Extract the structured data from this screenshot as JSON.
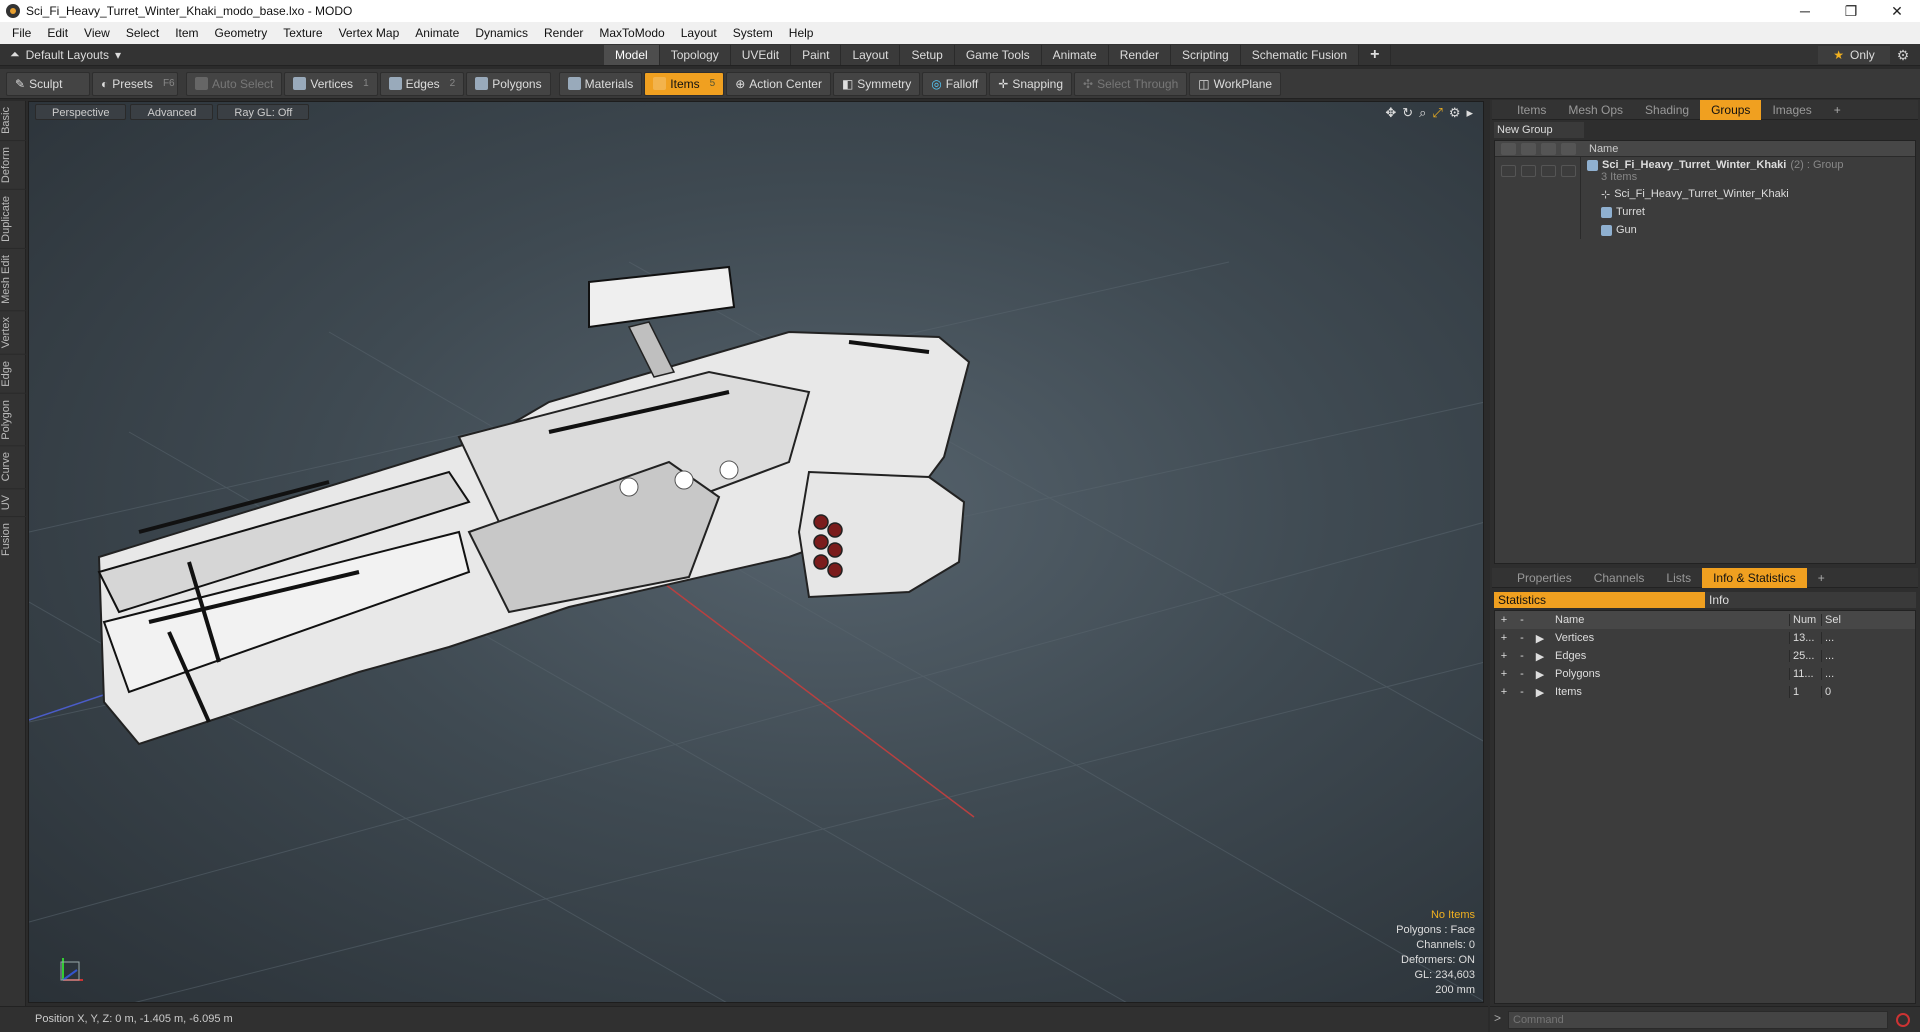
{
  "window": {
    "title": "Sci_Fi_Heavy_Turret_Winter_Khaki_modo_base.lxo - MODO"
  },
  "menu": [
    "File",
    "Edit",
    "View",
    "Select",
    "Item",
    "Geometry",
    "Texture",
    "Vertex Map",
    "Animate",
    "Dynamics",
    "Render",
    "MaxToModo",
    "Layout",
    "System",
    "Help"
  ],
  "layout": {
    "label": "Default Layouts",
    "tabs": [
      "Model",
      "Topology",
      "UVEdit",
      "Paint",
      "Layout",
      "Setup",
      "Game Tools",
      "Animate",
      "Render",
      "Scripting",
      "Schematic Fusion"
    ],
    "plus": "+",
    "only": "Only"
  },
  "toolbar": {
    "sculpt": "Sculpt",
    "presets": "Presets",
    "presets_key": "F6",
    "auto_select": "Auto Select",
    "vertices": "Vertices",
    "vertices_n": "1",
    "edges": "Edges",
    "edges_n": "2",
    "polygons": "Polygons",
    "materials": "Materials",
    "items": "Items",
    "items_n": "5",
    "action_center": "Action Center",
    "symmetry": "Symmetry",
    "falloff": "Falloff",
    "snapping": "Snapping",
    "select_through": "Select Through",
    "workplane": "WorkPlane"
  },
  "left_tabs": [
    "Basic",
    "Deform",
    "Duplicate",
    "Mesh Edit",
    "Vertex",
    "Edge",
    "Polygon",
    "Curve",
    "UV",
    "Fusion"
  ],
  "viewport": {
    "view": "Perspective",
    "shading": "Advanced",
    "raygl": "Ray GL: Off",
    "info": {
      "no_items": "No Items",
      "polygons": "Polygons : Face",
      "channels": "Channels: 0",
      "deformers": "Deformers: ON",
      "gl": "GL: 234,603",
      "scale": "200 mm"
    }
  },
  "groups_panel": {
    "tabs": [
      "Items",
      "Mesh Ops",
      "Shading",
      "Groups",
      "Images"
    ],
    "plus": "+",
    "new_group": "New Group",
    "name_header": "Name",
    "group_name": "Sci_Fi_Heavy_Turret_Winter_Khaki",
    "group_suffix": "(2) : Group",
    "group_count": "3 Items",
    "children": [
      "Sci_Fi_Heavy_Turret_Winter_Khaki",
      "Turret",
      "Gun"
    ]
  },
  "props_panel": {
    "tabs": [
      "Properties",
      "Channels",
      "Lists",
      "Info & Statistics"
    ],
    "plus": "+",
    "sub_tabs": [
      "Statistics",
      "Info"
    ],
    "headers": {
      "name": "Name",
      "num": "Num",
      "sel": "Sel"
    },
    "rows": [
      {
        "name": "Vertices",
        "num": "13...",
        "sel": "..."
      },
      {
        "name": "Edges",
        "num": "25...",
        "sel": "..."
      },
      {
        "name": "Polygons",
        "num": "11...",
        "sel": "..."
      },
      {
        "name": "Items",
        "num": "1",
        "sel": "0"
      }
    ]
  },
  "status": {
    "position": "Position X, Y, Z:  0 m, -1.405 m, -6.095 m"
  },
  "command": {
    "placeholder": "Command"
  },
  "colors": {
    "accent": "#f0a020",
    "panel": "#2e2e2e"
  }
}
